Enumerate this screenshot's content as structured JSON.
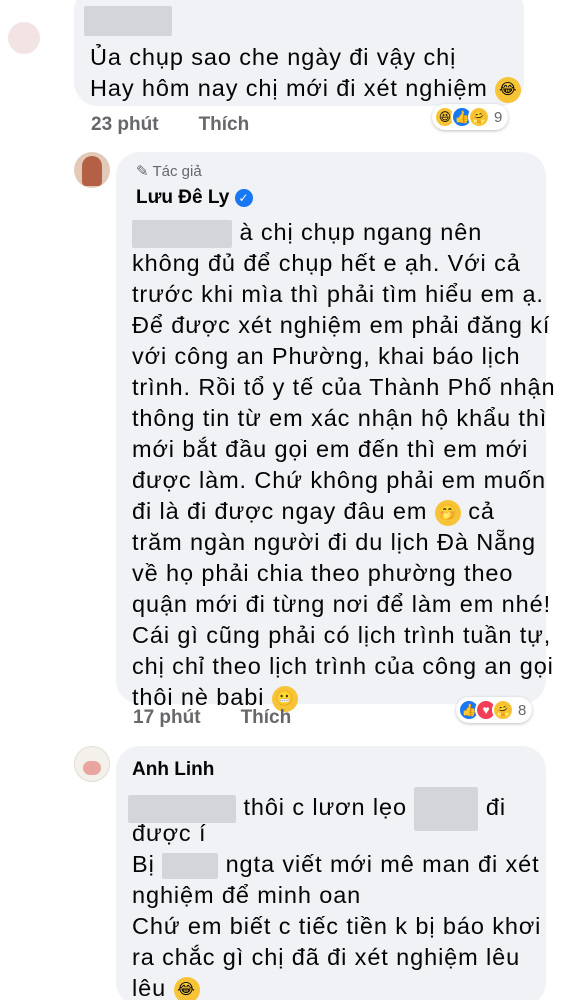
{
  "comment1": {
    "lines": [
      "Ủa chụp sao che ngày đi vậy chị",
      "Hay hôm nay chị mới đi xét nghiệm"
    ],
    "time": "23 phút",
    "like_label": "Thích",
    "reaction_count": "9",
    "reactions": [
      "haha-icon",
      "like-icon",
      "care-icon"
    ]
  },
  "comment2": {
    "author_badge": "Tác giả",
    "author": "Lưu Đê Ly",
    "lines": [
      "à chị chụp ngang nên",
      "không đủ để chụp hết e ạh. Với cả",
      "trước khi mìa thì phải tìm hiểu em ạ.",
      "Để được xét nghiệm em phải đăng kí",
      "với công an Phường, khai báo lịch",
      "trình. Rồi tổ y tế của Thành Phố nhận",
      "thông tin từ em xác nhận hộ khẩu thì",
      "mới bắt đầu gọi em đến thì em mới",
      "được làm. Chứ không phải em muốn",
      "đi là đi được ngay đâu em",
      "cả",
      "trăm ngàn người đi du lịch Đà Nẵng",
      "về họ phải chia theo phường theo",
      "quận mới đi từng nơi để làm em nhé!",
      "Cái gì cũng phải có lịch trình tuần tự,",
      "chị chỉ theo lịch trình của công an gọi",
      "thôi nè babi"
    ],
    "time": "17 phút",
    "like_label": "Thích",
    "reaction_count": "8",
    "reactions": [
      "like-icon",
      "love-icon",
      "care-icon"
    ]
  },
  "comment3": {
    "author": "Anh Linh",
    "line1_mid": "thôi c lươn lẹo",
    "line1_end": "đi",
    "line2": "được í",
    "line3_start": "Bị",
    "line3_end": "ngta viết mới mê man đi xét",
    "line4": "nghiệm để minh oan",
    "line5": "Chứ em biết c tiếc tiền k bị báo khơi",
    "line6": "ra chắc gì chị đã đi xét nghiệm lêu",
    "line7": "lêu"
  },
  "colors": {
    "bubble": "#f0f2f5",
    "meta": "#65676b",
    "like_blue": "#1877f2",
    "love_red": "#f33e58",
    "redact": "#d4d5d8"
  }
}
